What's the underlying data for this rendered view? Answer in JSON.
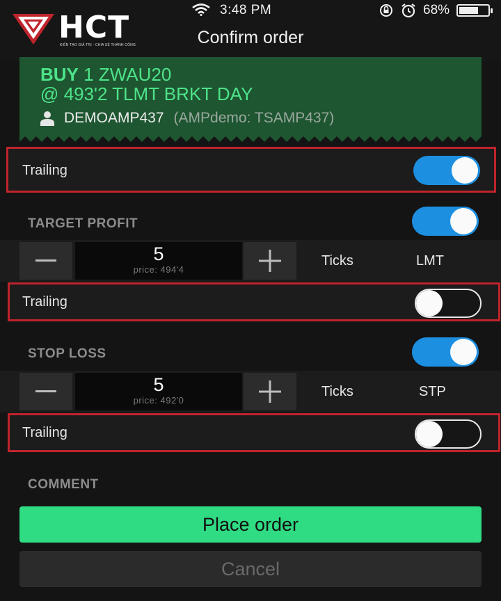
{
  "status_bar": {
    "time": "3:48 PM",
    "battery": "68%",
    "battery_level": 0.68
  },
  "header": {
    "title": "Confirm order",
    "logo_text": "HCT",
    "logo_tagline": "KIẾN TẠO GIÁ TRỊ - CHIA SẺ THÀNH CÔNG"
  },
  "order": {
    "action": "BUY",
    "qty_symbol": "1 ZWAU20",
    "details": "@ 493'2 TLMT BRKT DAY",
    "account": "DEMOAMP437",
    "account_sub": "(AMPdemo: TSAMP437)"
  },
  "trailing_main": {
    "label": "Trailing",
    "on": true
  },
  "target_profit": {
    "label": "TARGET PROFIT",
    "on": true,
    "value": "5",
    "price": "price: 494'4",
    "unit": "Ticks",
    "order_type": "LMT",
    "trailing": {
      "label": "Trailing",
      "on": false
    }
  },
  "stop_loss": {
    "label": "STOP LOSS",
    "on": true,
    "value": "5",
    "price": "price: 492'0",
    "unit": "Ticks",
    "order_type": "STP",
    "trailing": {
      "label": "Trailing",
      "on": false
    }
  },
  "comment": {
    "label": "COMMENT"
  },
  "buttons": {
    "place": "Place order",
    "cancel": "Cancel"
  },
  "colors": {
    "accent_blue": "#1d8fe1",
    "buy_green": "#4ee38a",
    "place_green": "#2fdc83",
    "highlight_red": "#c0242c"
  },
  "icons": [
    "wifi-icon",
    "orientation-lock-icon",
    "alarm-icon",
    "battery-icon",
    "user-icon",
    "minus-icon",
    "plus-icon"
  ]
}
